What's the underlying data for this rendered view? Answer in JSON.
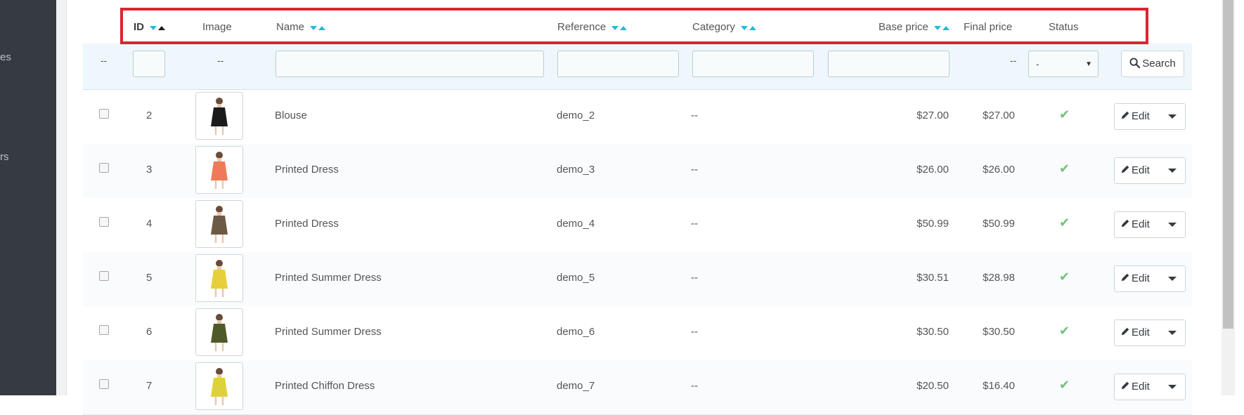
{
  "sidebar": {
    "items": [
      {
        "label": "es"
      },
      {
        "label": "rs"
      }
    ]
  },
  "table": {
    "headers": {
      "id": "ID",
      "image": "Image",
      "name": "Name",
      "reference": "Reference",
      "category": "Category",
      "base_price": "Base price",
      "final_price": "Final price",
      "status": "Status"
    },
    "filters": {
      "bulk": "--",
      "image": "--",
      "final_price": "--",
      "status_selected": "-",
      "search_label": "Search"
    },
    "rows": [
      {
        "id": "2",
        "name": "Blouse",
        "reference": "demo_2",
        "category": "--",
        "base_price": "$27.00",
        "final_price": "$27.00",
        "dress_color": "#1b1b1b"
      },
      {
        "id": "3",
        "name": "Printed Dress",
        "reference": "demo_3",
        "category": "--",
        "base_price": "$26.00",
        "final_price": "$26.00",
        "dress_color": "#ef7a5a"
      },
      {
        "id": "4",
        "name": "Printed Dress",
        "reference": "demo_4",
        "category": "--",
        "base_price": "$50.99",
        "final_price": "$50.99",
        "dress_color": "#6d5a45"
      },
      {
        "id": "5",
        "name": "Printed Summer Dress",
        "reference": "demo_5",
        "category": "--",
        "base_price": "$30.51",
        "final_price": "$28.98",
        "dress_color": "#e6cf3a"
      },
      {
        "id": "6",
        "name": "Printed Summer Dress",
        "reference": "demo_6",
        "category": "--",
        "base_price": "$30.50",
        "final_price": "$30.50",
        "dress_color": "#4e5a2a"
      },
      {
        "id": "7",
        "name": "Printed Chiffon Dress",
        "reference": "demo_7",
        "category": "--",
        "base_price": "$20.50",
        "final_price": "$16.40",
        "dress_color": "#ddd23a"
      }
    ],
    "edit_label": "Edit"
  },
  "colors": {
    "accent": "#25b9d7",
    "highlight": "#d92631",
    "status_ok": "#72c279",
    "sidebar": "#363a41"
  }
}
